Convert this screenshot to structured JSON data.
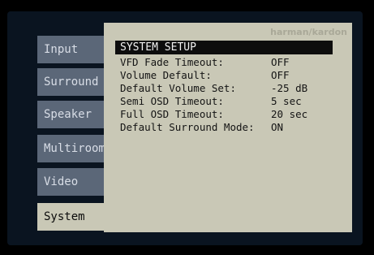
{
  "menu": {
    "tabs": [
      {
        "label": "Input"
      },
      {
        "label": "Surround"
      },
      {
        "label": "Speaker"
      },
      {
        "label": "Multiroom"
      },
      {
        "label": "Video"
      },
      {
        "label": "System"
      }
    ],
    "active_tab": "System"
  },
  "panel": {
    "brand": "harman/kardon",
    "title": "SYSTEM SETUP",
    "settings": [
      {
        "label": "VFD Fade Timeout:",
        "value": "OFF"
      },
      {
        "label": "Volume Default:",
        "value": "OFF"
      },
      {
        "label": "Default Volume Set:",
        "value": "-25 dB"
      },
      {
        "label": "Semi OSD Timeout:",
        "value": "5 sec"
      },
      {
        "label": "Full OSD Timeout:",
        "value": "20 sec"
      },
      {
        "label": "Default Surround Mode:",
        "value": "ON"
      }
    ]
  },
  "colors": {
    "screen_background": "#0a1420",
    "tab_inactive": "#5b6778",
    "tab_active": "#c9c8b6",
    "panel_background": "#c9c8b6",
    "title_bar": "#0d0d0d"
  }
}
